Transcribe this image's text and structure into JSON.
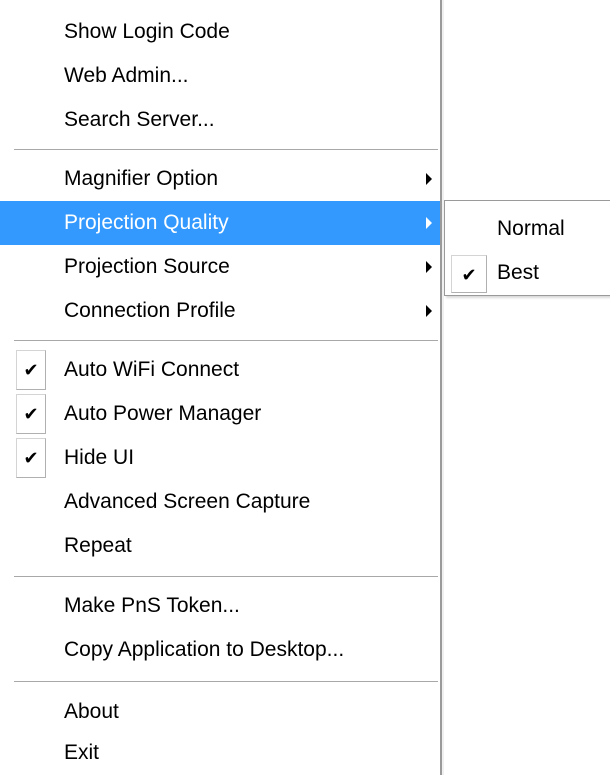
{
  "menu": {
    "items": [
      {
        "label": "Show Login Code"
      },
      {
        "label": "Web Admin..."
      },
      {
        "label": "Search Server..."
      },
      {
        "label": "Magnifier Option"
      },
      {
        "label": "Projection Quality"
      },
      {
        "label": "Projection Source"
      },
      {
        "label": "Connection Profile"
      },
      {
        "label": "Auto WiFi Connect"
      },
      {
        "label": "Auto Power Manager"
      },
      {
        "label": "Hide UI"
      },
      {
        "label": "Advanced Screen Capture"
      },
      {
        "label": "Repeat"
      },
      {
        "label": "Make PnS Token..."
      },
      {
        "label": "Copy Application to Desktop..."
      },
      {
        "label": "About"
      },
      {
        "label": "Exit"
      }
    ],
    "check_mark": "✔"
  },
  "submenu": {
    "items": [
      {
        "label": "Normal"
      },
      {
        "label": "Best"
      }
    ],
    "check_mark": "✔"
  },
  "colors": {
    "highlight": "#3399ff",
    "highlight_text": "#ffffff"
  }
}
